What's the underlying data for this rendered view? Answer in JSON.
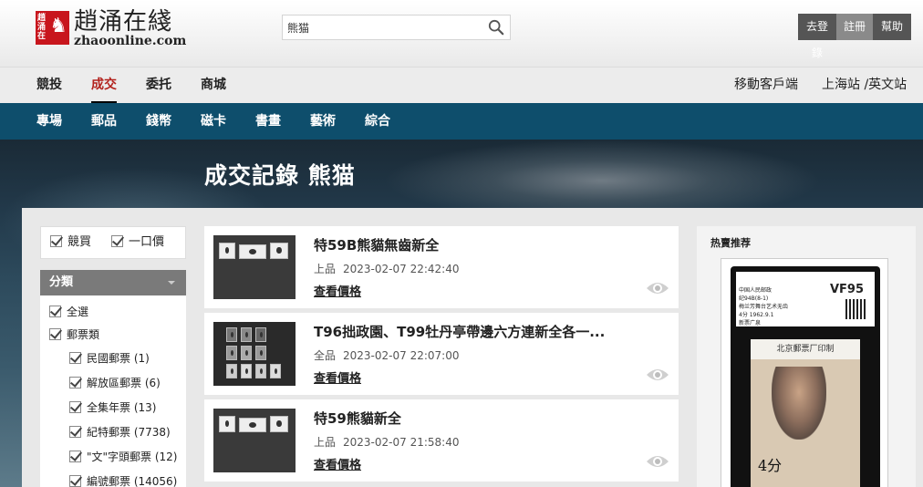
{
  "header": {
    "logo_cn": "趙涌在綫",
    "logo_en": "zhaoonline.com",
    "search_value": "熊猫",
    "login": "去登錄",
    "register": "註冊",
    "help": "幫助"
  },
  "nav": {
    "items": [
      "競投",
      "成交",
      "委托",
      "商城"
    ],
    "active": "成交",
    "mobile": "移動客戶端",
    "site": "上海站 /英文站"
  },
  "subnav": {
    "items": [
      "專場",
      "郵品",
      "錢幣",
      "磁卡",
      "書畫",
      "藝術",
      "綜合"
    ]
  },
  "banner": {
    "title": "成交記錄 熊猫"
  },
  "filters": {
    "auction": "競買",
    "fixed_price": "一口價"
  },
  "categories": {
    "header": "分類",
    "all": "全選",
    "stamps": "郵票類",
    "items": [
      "民國郵票 (1)",
      "解放區郵票 (6)",
      "全集年票 (13)",
      "紀特郵票 (7738)",
      "\"文\"字頭郵票 (12)",
      "編號郵票 (14056)"
    ]
  },
  "results": [
    {
      "title": "特59B熊貓無齒新全",
      "status": "上品",
      "time": "2023-02-07 22:42:40",
      "link": "查看價格"
    },
    {
      "title": "T96拙政園、T99牡丹亭帶邊六方連新全各一...",
      "status": "全品",
      "time": "2023-02-07 22:07:00",
      "link": "查看價格"
    },
    {
      "title": "特59熊貓新全",
      "status": "上品",
      "time": "2023-02-07 21:58:40",
      "link": "查看價格"
    }
  ],
  "recommend": {
    "header": "热賣推荐",
    "grade": "VF95",
    "label_lines": [
      "中国人民邮政",
      "纪94B(8-1)",
      "梅兰芳舞台艺术无齿",
      "4分 1962.9.1",
      "新票广泉"
    ],
    "stamp_header": "北京郵票厂印制",
    "value": "4分"
  },
  "colors": {
    "accent_red": "#b3221d",
    "subnav_bg": "#0e4e6c",
    "logo_red": "#c8161d"
  }
}
